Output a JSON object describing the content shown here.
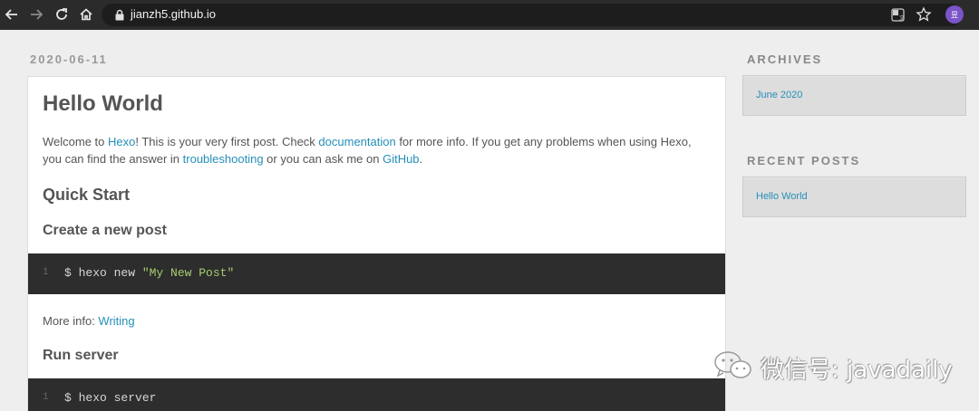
{
  "browser": {
    "url": "jianzh5.github.io",
    "avatar_initial": "昱"
  },
  "post": {
    "date": "2020-06-11",
    "title": "Hello World",
    "intro": {
      "t1": "Welcome to ",
      "link_hexo": "Hexo",
      "t2": "! This is your very first post. Check ",
      "link_docs": "documentation",
      "t3": " for more info. If you get any problems when using Hexo, you can find the answer in ",
      "link_trouble": "troubleshooting",
      "t4": " or you can ask me on ",
      "link_github": "GitHub",
      "t5": "."
    },
    "quick_start": "Quick Start",
    "create_post": "Create a new post",
    "code1": {
      "line": "1",
      "cmd": "$ hexo new ",
      "str": "\"My New Post\""
    },
    "more_info": {
      "label": "More info: ",
      "link": "Writing"
    },
    "run_server": "Run server",
    "code2": {
      "line": "1",
      "cmd": "$ hexo server"
    }
  },
  "sidebar": {
    "archives_title": "ARCHIVES",
    "archives_item": "June 2020",
    "recent_title": "RECENT POSTS",
    "recent_item": "Hello World"
  },
  "watermark": "微信号: javadaily",
  "colors": {
    "link": "#258fb8",
    "chrome": "#2b2b2b",
    "code_bg": "#2d2d2d",
    "code_string": "#a6cc70"
  }
}
